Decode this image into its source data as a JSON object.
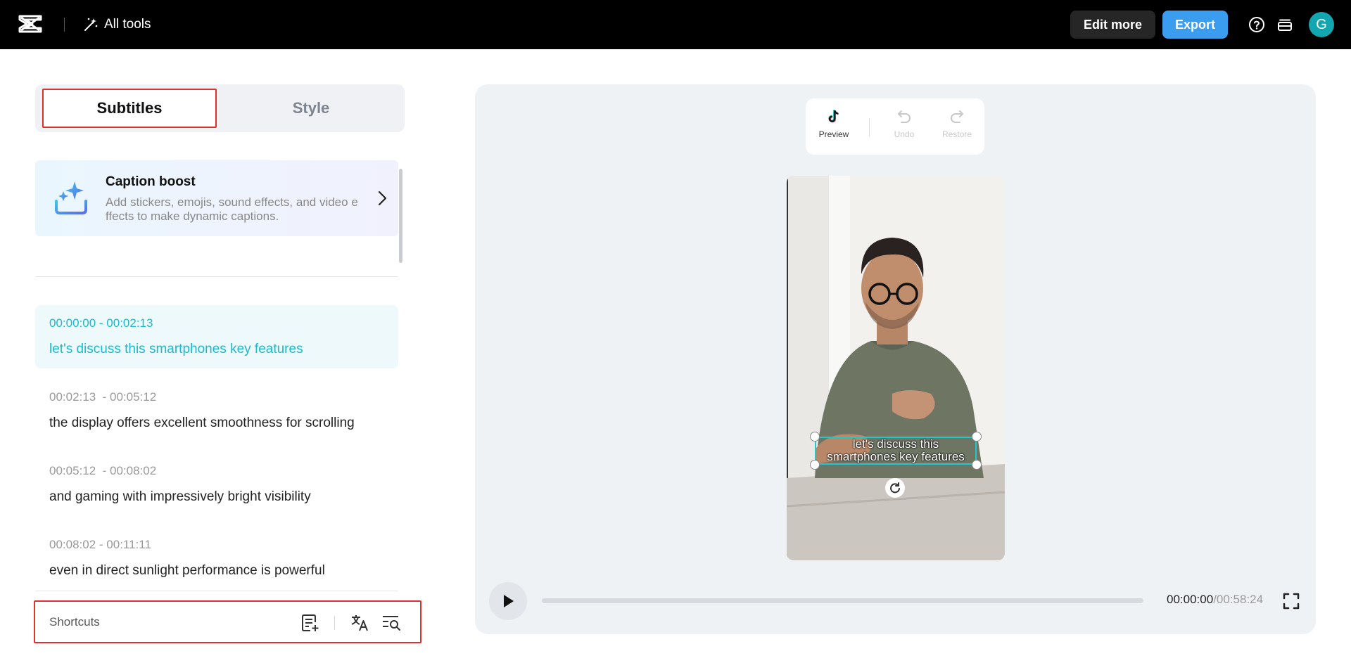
{
  "header": {
    "all_tools_label": "All tools",
    "edit_more_label": "Edit more",
    "export_label": "Export",
    "avatar_initial": "G",
    "export_color": "#3b9df0"
  },
  "tabs": [
    {
      "label": "Subtitles",
      "selected": true
    },
    {
      "label": "Style",
      "selected": false
    }
  ],
  "caption_boost": {
    "title": "Caption boost",
    "description": "Add stickers, emojis, sound effects, and video effects to make dynamic captions."
  },
  "subtitles": [
    {
      "time": "00:00:00 - 00:02:13",
      "text": "let's discuss this smartphones key features",
      "active": true
    },
    {
      "time": "00:02:13  - 00:05:12",
      "text": "the display offers excellent smoothness for scrolling",
      "active": false
    },
    {
      "time": "00:05:12  - 00:08:02",
      "text": "and gaming with impressively bright visibility",
      "active": false
    },
    {
      "time": "00:08:02 - 00:11:11",
      "text": "even in direct sunlight performance is powerful",
      "active": false
    }
  ],
  "shortcuts": {
    "label": "Shortcuts",
    "icons": [
      "add-subtitle-icon",
      "translate-icon",
      "search-list-icon"
    ]
  },
  "toolbar": {
    "preview_label": "Preview",
    "undo_label": "Undo",
    "restore_label": "Restore"
  },
  "video": {
    "caption_line1": "let's discuss this",
    "caption_line2": "smartphones key features"
  },
  "playback": {
    "current_time": "00:00:00",
    "total_time": "/00:58:24",
    "progress": 0
  },
  "colors": {
    "accent": "#1fb8cc",
    "highlight_border": "#e0302a"
  }
}
